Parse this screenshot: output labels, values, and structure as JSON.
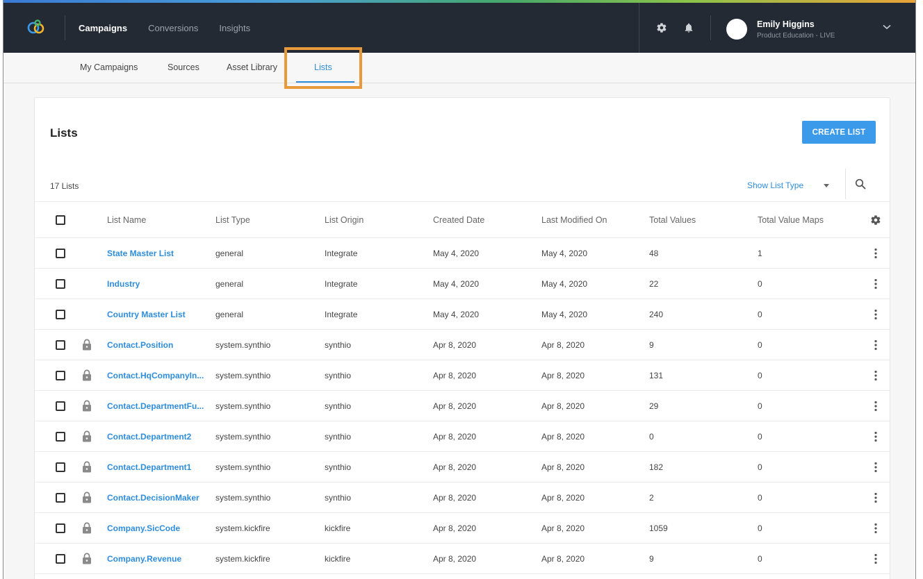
{
  "topbar": {
    "nav": [
      {
        "label": "Campaigns",
        "active": true
      },
      {
        "label": "Conversions",
        "active": false
      },
      {
        "label": "Insights",
        "active": false
      }
    ],
    "user": {
      "name": "Emily Higgins",
      "org": "Product Education - LIVE"
    }
  },
  "subnav": {
    "tabs": [
      {
        "label": "My Campaigns"
      },
      {
        "label": "Sources"
      },
      {
        "label": "Asset Library"
      },
      {
        "label": "Lists",
        "active": true
      }
    ]
  },
  "page": {
    "title": "Lists",
    "create_button": "CREATE LIST",
    "count": "17 Lists",
    "filter_label": "Show List Type"
  },
  "table": {
    "columns": [
      "List Name",
      "List Type",
      "List Origin",
      "Created Date",
      "Last Modified On",
      "Total Values",
      "Total Value Maps"
    ],
    "rows": [
      {
        "name": "State Master List",
        "locked": false,
        "type": "general",
        "origin": "Integrate",
        "created": "May 4, 2020",
        "modified": "May 4, 2020",
        "values": "48",
        "maps": "1"
      },
      {
        "name": "Industry",
        "locked": false,
        "type": "general",
        "origin": "Integrate",
        "created": "May 4, 2020",
        "modified": "May 4, 2020",
        "values": "22",
        "maps": "0"
      },
      {
        "name": "Country Master List",
        "locked": false,
        "type": "general",
        "origin": "Integrate",
        "created": "May 4, 2020",
        "modified": "May 4, 2020",
        "values": "240",
        "maps": "0"
      },
      {
        "name": "Contact.Position",
        "locked": true,
        "type": "system.synthio",
        "origin": "synthio",
        "created": "Apr 8, 2020",
        "modified": "Apr 8, 2020",
        "values": "9",
        "maps": "0"
      },
      {
        "name": "Contact.HqCompanyIn...",
        "locked": true,
        "type": "system.synthio",
        "origin": "synthio",
        "created": "Apr 8, 2020",
        "modified": "Apr 8, 2020",
        "values": "131",
        "maps": "0"
      },
      {
        "name": "Contact.DepartmentFu...",
        "locked": true,
        "type": "system.synthio",
        "origin": "synthio",
        "created": "Apr 8, 2020",
        "modified": "Apr 8, 2020",
        "values": "29",
        "maps": "0"
      },
      {
        "name": "Contact.Department2",
        "locked": true,
        "type": "system.synthio",
        "origin": "synthio",
        "created": "Apr 8, 2020",
        "modified": "Apr 8, 2020",
        "values": "0",
        "maps": "0"
      },
      {
        "name": "Contact.Department1",
        "locked": true,
        "type": "system.synthio",
        "origin": "synthio",
        "created": "Apr 8, 2020",
        "modified": "Apr 8, 2020",
        "values": "182",
        "maps": "0"
      },
      {
        "name": "Contact.DecisionMaker",
        "locked": true,
        "type": "system.synthio",
        "origin": "synthio",
        "created": "Apr 8, 2020",
        "modified": "Apr 8, 2020",
        "values": "2",
        "maps": "0"
      },
      {
        "name": "Company.SicCode",
        "locked": true,
        "type": "system.kickfire",
        "origin": "kickfire",
        "created": "Apr 8, 2020",
        "modified": "Apr 8, 2020",
        "values": "1059",
        "maps": "0"
      },
      {
        "name": "Company.Revenue",
        "locked": true,
        "type": "system.kickfire",
        "origin": "kickfire",
        "created": "Apr 8, 2020",
        "modified": "Apr 8, 2020",
        "values": "9",
        "maps": "0"
      }
    ]
  },
  "icons": {
    "logo": "brand-logo",
    "settings": "gear-icon",
    "notifications": "bell-icon",
    "user_menu": "chevron-down-icon",
    "filter_caret": "caret-down-icon",
    "search": "search-icon",
    "column_settings": "gear-icon",
    "row_lock": "lock-icon",
    "row_menu": "kebab-menu-icon"
  },
  "colors": {
    "topbar": "#232a33",
    "accent_blue": "#2e8ddc",
    "button": "#3b9aea",
    "highlight": "#e89a3b"
  }
}
